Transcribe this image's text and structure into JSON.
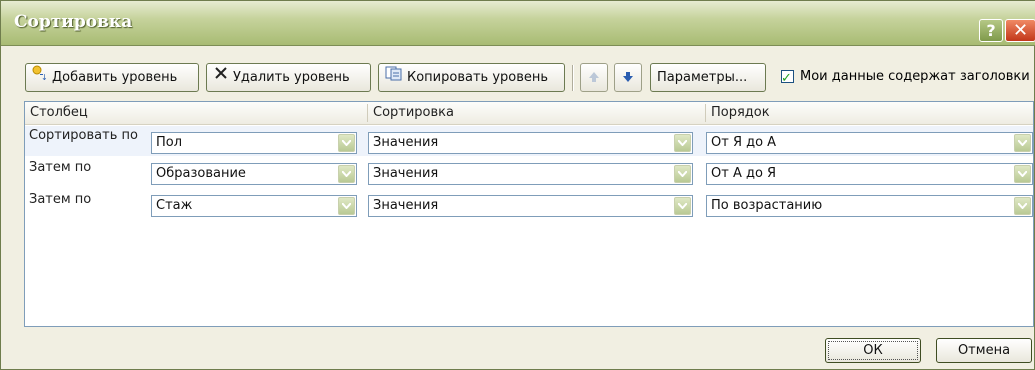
{
  "window": {
    "title": "Сортировка",
    "help_label": "?",
    "close_label": "✕"
  },
  "toolbar": {
    "add_level": "Добавить уровень",
    "delete_level": "Удалить уровень",
    "copy_level": "Копировать уровень",
    "options": "Параметры...",
    "headers_checkbox_label": "Мои данные содержат заголовки",
    "headers_checked": true
  },
  "grid": {
    "headers": {
      "column": "Столбец",
      "sort_on": "Сортировка",
      "order": "Порядок"
    },
    "rows": [
      {
        "label": "Сортировать по",
        "column": "Пол",
        "sort_on": "Значения",
        "order": "От Я до А"
      },
      {
        "label": "Затем по",
        "column": "Образование",
        "sort_on": "Значения",
        "order": "От А до Я"
      },
      {
        "label": "Затем по",
        "column": "Стаж",
        "sort_on": "Значения",
        "order": "По возрастанию"
      }
    ]
  },
  "footer": {
    "ok": "ОК",
    "cancel": "Отмена"
  },
  "colors": {
    "title_bar": "#a8bb73",
    "dialog_bg": "#f1efe2",
    "accent_blue": "#2a5db0"
  }
}
